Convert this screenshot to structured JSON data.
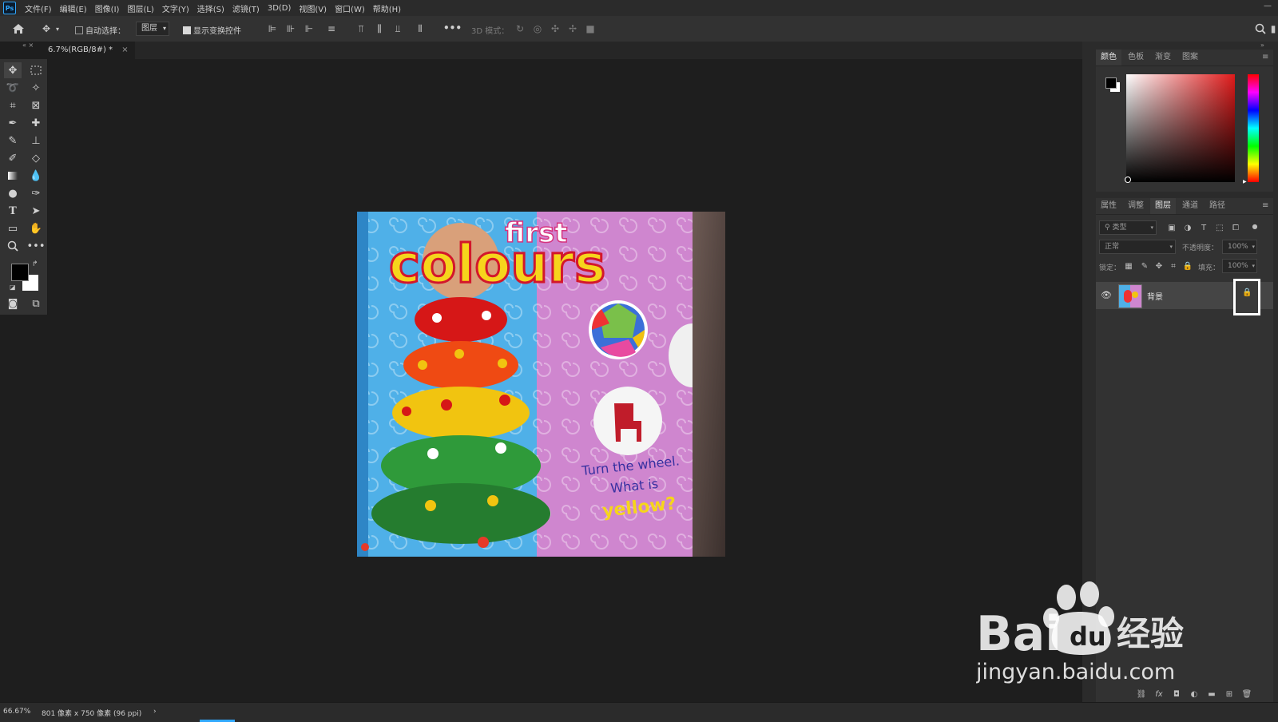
{
  "app": {
    "logo": "Ps",
    "menu": [
      "文件(F)",
      "编辑(E)",
      "图像(I)",
      "图层(L)",
      "文字(Y)",
      "选择(S)",
      "滤镜(T)",
      "3D(D)",
      "视图(V)",
      "窗口(W)",
      "帮助(H)"
    ],
    "window_controls": "—"
  },
  "options_bar": {
    "auto_select_label": "自动选择：",
    "auto_select_checked": false,
    "auto_select_target": "图层",
    "show_transform_label": "显示变换控件",
    "show_transform_checked": true,
    "more": "•••",
    "mode_3d_label": "3D 模式："
  },
  "document_tab": {
    "title": "6.7%(RGB/8#) *",
    "close": "×"
  },
  "image": {
    "title_small": "first",
    "title_big": "colours",
    "caption_line1": "Turn the wheel.",
    "caption_line2": "What is",
    "caption_line3": "yellow?"
  },
  "color_panel": {
    "tabs": [
      "颜色",
      "色板",
      "渐变",
      "图案"
    ],
    "active_tab": 0,
    "foreground": "#000000",
    "background": "#ffffff",
    "hue_color": "#e01b1b"
  },
  "layers_panel": {
    "tabs": [
      "属性",
      "调整",
      "图层",
      "通道",
      "路径"
    ],
    "active_tab": 2,
    "filter_placeholder": "类型",
    "blend_mode": "正常",
    "opacity_label": "不透明度：",
    "opacity_value": "100%",
    "lock_label": "锁定：",
    "fill_label": "填充：",
    "fill_value": "100%",
    "layers": [
      {
        "name": "背景",
        "visible": true,
        "locked": true
      }
    ]
  },
  "status_bar": {
    "zoom": "66.67%",
    "doc_info": "801 像素 x 750 像素 (96 ppi)",
    "arrow": "›"
  },
  "watermark": {
    "brand_left": "Bai",
    "brand_right": "经验",
    "url": "jingyan.baidu.com"
  },
  "colors": {
    "accent": "#31a8ff",
    "panel_bg": "#323232",
    "canvas_bg": "#1e1e1e"
  }
}
